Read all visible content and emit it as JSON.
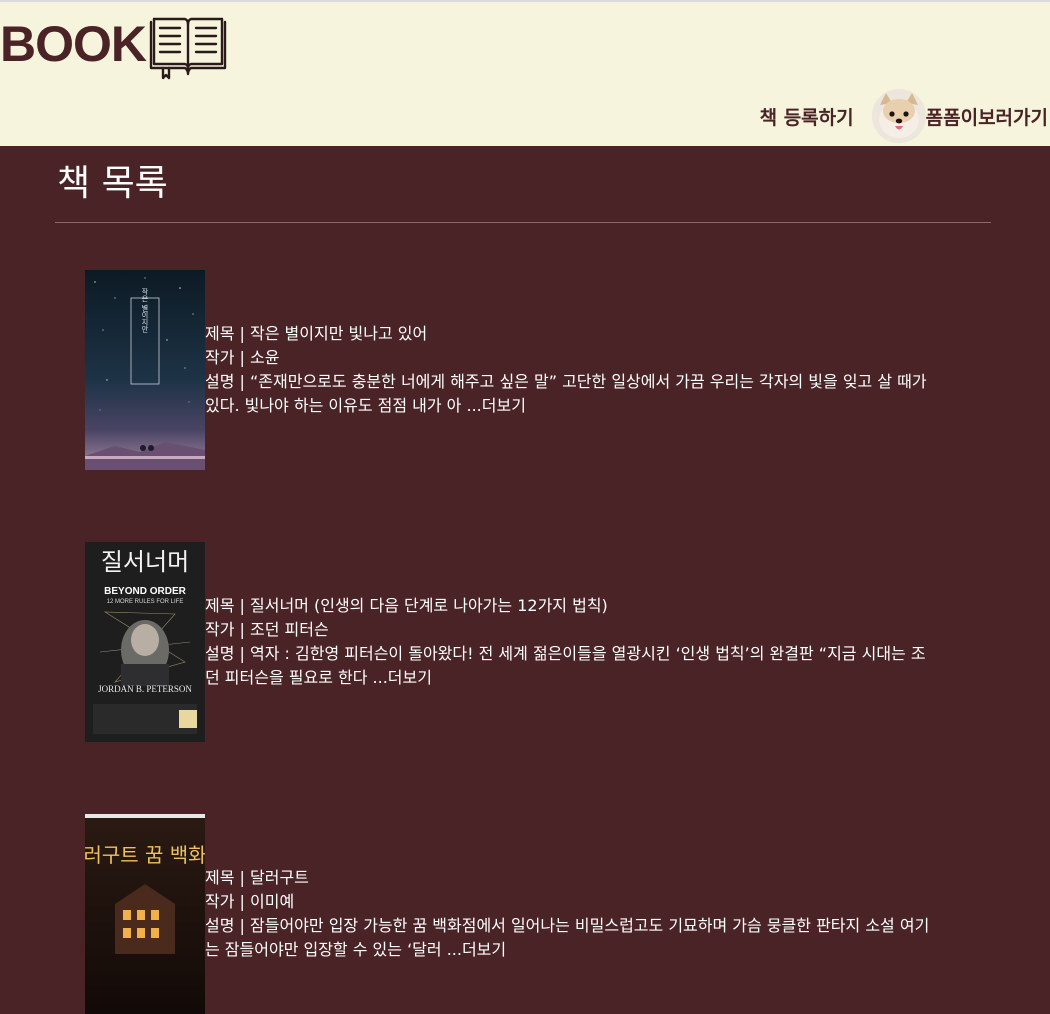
{
  "header": {
    "logo_text": "BOOK",
    "nav": {
      "register_label": "책 등록하기",
      "profile_label": "폼폼이보러가기"
    }
  },
  "main": {
    "title": "책 목록",
    "books": [
      {
        "title_label": "제목 | ",
        "title": "작은 별이지만 빛나고 있어",
        "author_label": "작가 | ",
        "author": "소윤",
        "desc_label": "설명 | ",
        "desc": "“존재만으로도 충분한 너에게 해주고 싶은 말” 고단한 일상에서 가끔 우리는 각자의 빛을 잊고 살 때가 있다. 빛나야 하는 이유도 점점 내가 아 ",
        "more": "...더보기",
        "cover_text": "작은 별이지만 빛나고 있어"
      },
      {
        "title_label": "제목 | ",
        "title": "질서너머 (인생의 다음 단계로 나아가는 12가지 법칙)",
        "author_label": "작가 | ",
        "author": "조던 피터슨",
        "desc_label": "설명 | ",
        "desc": "역자 : 김한영 피터슨이 돌아왔다! 전 세계 젊은이들을 열광시킨 ‘인생 법칙’의 완결판 “지금 시대는 조던 피터슨을 필요로 한다 ",
        "more": "...더보기",
        "cover_title": "질서너머",
        "cover_en1": "BEYOND ORDER",
        "cover_en2": "12 MORE RULES FOR LIFE",
        "cover_author": "JORDAN B. PETERSON"
      },
      {
        "title_label": "제목 | ",
        "title": "달러구트",
        "author_label": "작가 | ",
        "author": "이미예",
        "desc_label": "설명 | ",
        "desc": "잠들어야만 입장 가능한 꿈 백화점에서 일어나는 비밀스럽고도 기묘하며 가슴 뭉클한 판타지 소설 여기는 잠들어야만 입장할 수 있는 ‘달러 ",
        "more": "...더보기",
        "cover_title": "달러구트 꿈 백화점"
      }
    ]
  },
  "colors": {
    "header_bg": "#f6f4dc",
    "main_bg": "#4a2326",
    "brand": "#4a2326",
    "text": "#ffffff"
  },
  "icons": {
    "logo_icon": "open-book-icon",
    "avatar": "pomeranian-avatar"
  }
}
